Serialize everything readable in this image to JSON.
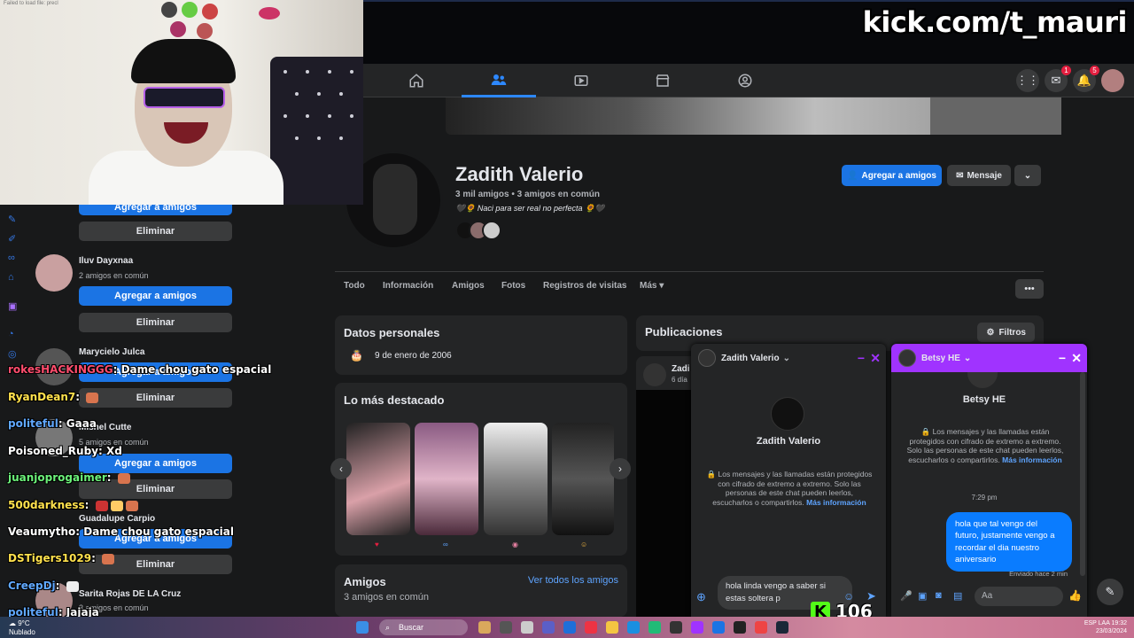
{
  "stream": {
    "url": "kick.com/t_mauri",
    "viewer_count": "106",
    "kick_letter": "K",
    "webcam_error": "Failed to load file: precl"
  },
  "nav": {
    "icons": [
      "home-icon",
      "friends-icon",
      "watch-icon",
      "marketplace-icon",
      "groups-icon"
    ],
    "messenger_badge": "1",
    "notifications_badge": "5"
  },
  "suggestions": {
    "items": [
      {
        "name": "",
        "mutual": "",
        "add_label": "Agregar a amigos",
        "remove_label": "Eliminar"
      },
      {
        "name": "Iluv Dayxnaa",
        "mutual": "2 amigos en común",
        "add_label": "Agregar a amigos",
        "remove_label": "Eliminar"
      },
      {
        "name": "Marycielo Julca",
        "mutual": "",
        "add_label": "Agregar a amigos",
        "remove_label": "Eliminar"
      },
      {
        "name": "Mishel Cutte",
        "mutual": "5 amigos en común",
        "add_label": "Agregar a amigos",
        "remove_label": "Eliminar"
      },
      {
        "name": "Guadalupe Carpio",
        "mutual": "",
        "add_label": "Agregar a amigos",
        "remove_label": "Eliminar"
      },
      {
        "name": "Sarita Rojas DE LA Cruz",
        "mutual": "3 amigos en común"
      }
    ]
  },
  "chat_overlay": [
    {
      "user": "rokesHACKINGGG",
      "text": "Dame chou gato espacial",
      "color": "#ff4d6d"
    },
    {
      "user": "RyanDean7",
      "text": "",
      "color": "#ffe14d"
    },
    {
      "user": "politeful",
      "text": "Gaaa",
      "color": "#60a8ff"
    },
    {
      "user": "Poisoned_Ruby",
      "text": "Xd",
      "color": "#ffffff"
    },
    {
      "user": "juanjoprogaimer",
      "text": "",
      "color": "#6cf27a"
    },
    {
      "user": "500darkness",
      "text": "",
      "color": "#ffe14d"
    },
    {
      "user": "Veaumytho",
      "text": "Dame chou gato espacial",
      "color": "#ffffff"
    },
    {
      "user": "DSTigers1029",
      "text": "",
      "color": "#ffe14d"
    },
    {
      "user": "CreepDj",
      "text": "",
      "color": "#60a8ff"
    },
    {
      "user": "politeful",
      "text": "Jajaja",
      "color": "#60a8ff"
    }
  ],
  "profile": {
    "name": "Zadith Valerio",
    "friends": "3 mil amigos • 3 amigos en común",
    "bio": "🖤🌻 Naci para ser real no perfecta 🌻🖤",
    "add_friend_label": "Agregar a amigos",
    "message_label": "Mensaje",
    "tabs": [
      "Todo",
      "Información",
      "Amigos",
      "Fotos",
      "Registros de visitas",
      "Más ▾"
    ]
  },
  "personal_data": {
    "title": "Datos personales",
    "birthday": "9 de enero de 2006"
  },
  "highlights": {
    "title": "Lo más destacado"
  },
  "friends_card": {
    "title": "Amigos",
    "subtitle": "3 amigos en común",
    "see_all": "Ver todos los amigos"
  },
  "posts": {
    "title": "Publicaciones",
    "filters_label": "Filtros",
    "post_author_short": "Zadi",
    "post_time_short": "6 día"
  },
  "chat1": {
    "name": "Zadith Valerio",
    "e2e_text": "Los mensajes y las llamadas están protegidos con cifrado de extremo a extremo. Solo las personas de este chat pueden leerlos, escucharlos o compartirlos.",
    "more_info": "Más información",
    "draft": "hola linda vengo a saber si estas soltera p"
  },
  "chat2": {
    "name": "Betsy HE",
    "e2e_text": "Los mensajes y las llamadas están protegidos con cifrado de extremo a extremo. Solo las personas de este chat pueden leerlos, escucharlos o compartirlos.",
    "more_info": "Más información",
    "time": "7:29 pm",
    "sent_message": "hola que tal vengo del futuro, justamente vengo a recordar el dia nuestro aniversario",
    "sent_status": "Enviado hace 2 min",
    "input_placeholder": "Aa"
  },
  "taskbar": {
    "weather_temp": "9°C",
    "weather_desc": "Nublado",
    "search": "Buscar",
    "lang1": "ESP",
    "lang2": "LAA",
    "time": "19:32",
    "date": "23/03/2024"
  },
  "colors": {
    "fb_blue": "#1b74e4",
    "messenger_purple": "#a033ff",
    "kick_green": "#53fc18"
  }
}
